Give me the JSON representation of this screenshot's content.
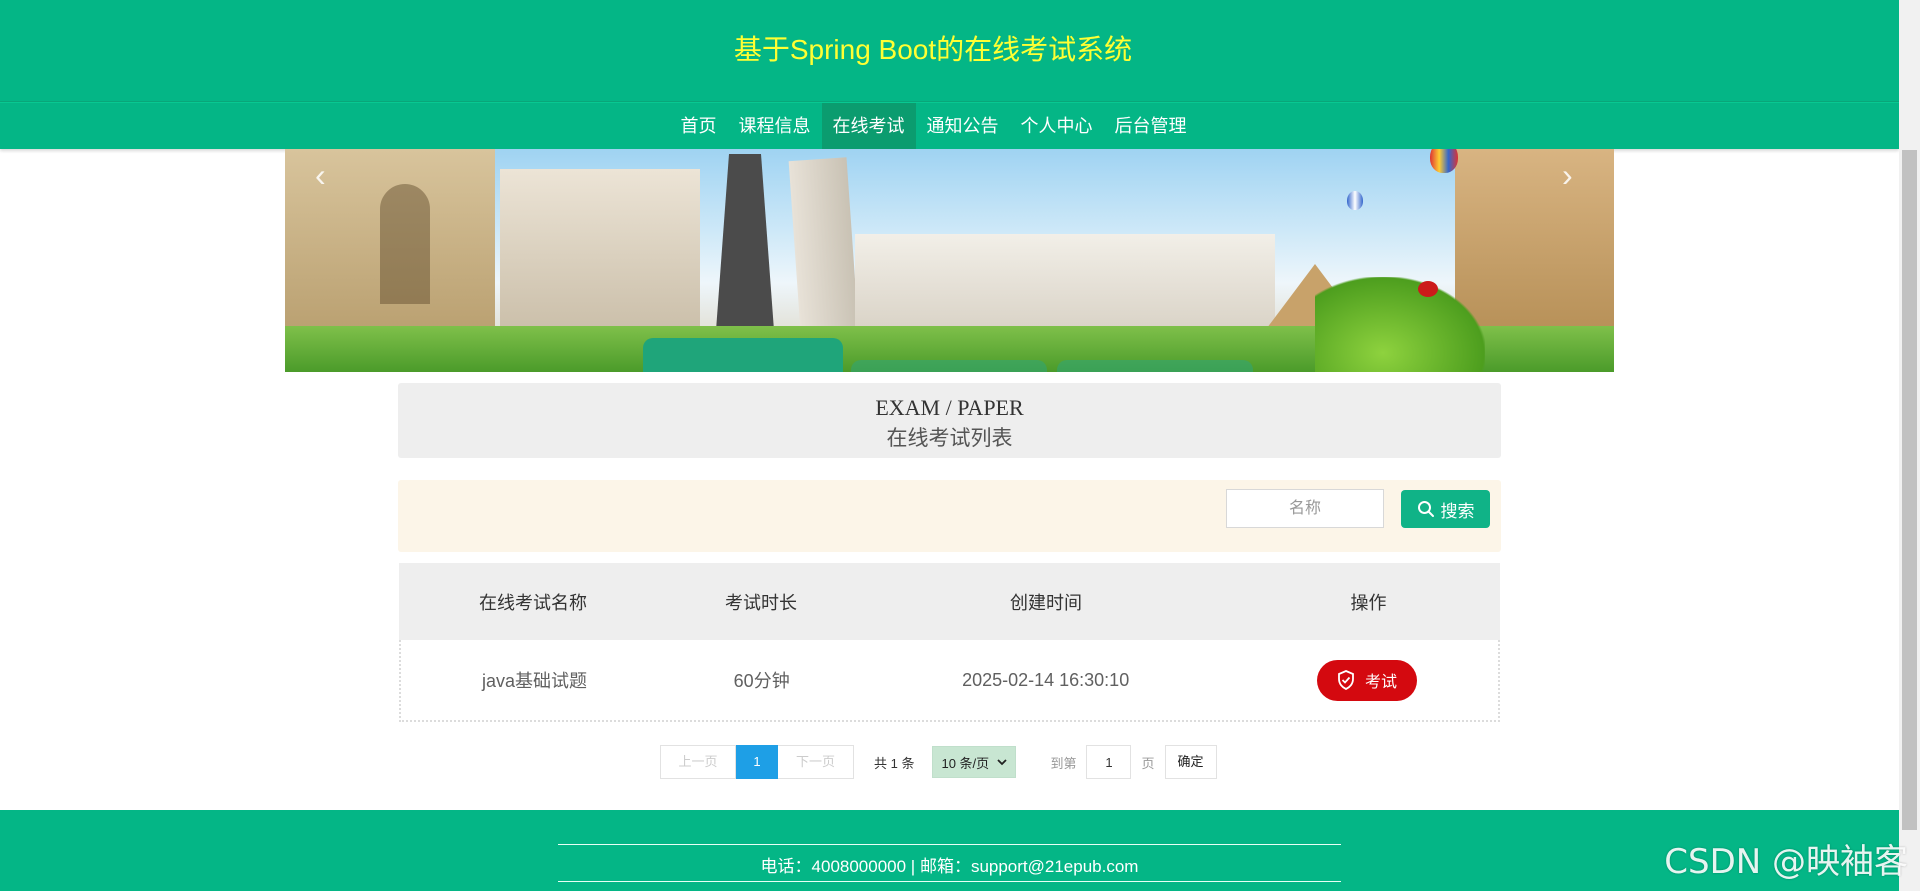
{
  "header": {
    "title": "基于Spring Boot的在线考试系统"
  },
  "nav": {
    "items": [
      {
        "label": "首页"
      },
      {
        "label": "课程信息"
      },
      {
        "label": "在线考试"
      },
      {
        "label": "通知公告"
      },
      {
        "label": "个人中心"
      },
      {
        "label": "后台管理"
      }
    ],
    "active": "在线考试"
  },
  "section": {
    "title_en": "EXAM / PAPER",
    "title_cn": "在线考试列表"
  },
  "search": {
    "placeholder": "名称",
    "value": "",
    "button_label": "搜索"
  },
  "table": {
    "headers": [
      "在线考试名称",
      "考试时长",
      "创建时间",
      "操作"
    ],
    "rows": [
      {
        "name": "java基础试题",
        "duration": "60分钟",
        "created": "2025-02-14 16:30:10",
        "action": "考试"
      }
    ]
  },
  "pagination": {
    "prev": "上一页",
    "current": "1",
    "next": "下一页",
    "total_text": "共 1 条",
    "page_size": "10 条/页",
    "goto_label": "到第",
    "goto_value": "1",
    "page_unit": "页",
    "confirm": "确定"
  },
  "footer": {
    "contact": "电话：4008000000 | 邮箱：support@21epub.com"
  },
  "watermark": "CSDN @映袖客",
  "colors": {
    "primary": "#04b686",
    "title_yellow": "#ffff33",
    "action_red": "#d4090f",
    "page_blue": "#1e9fe6"
  }
}
